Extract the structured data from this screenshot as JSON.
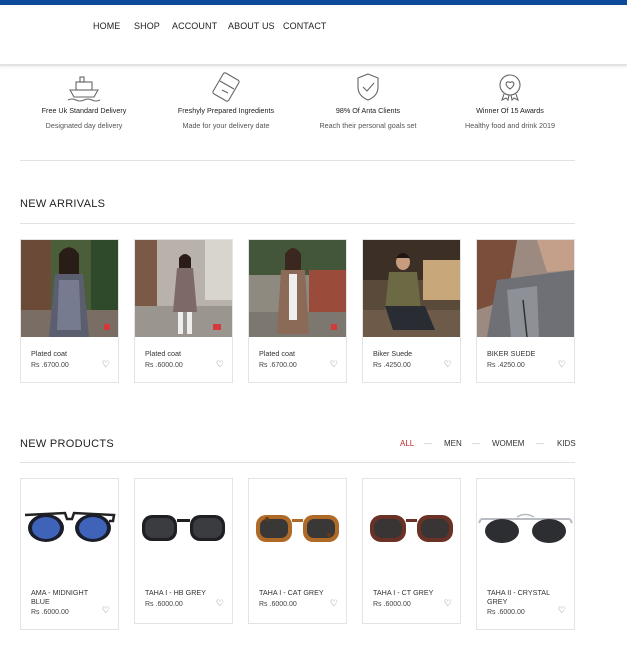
{
  "nav": {
    "items": [
      "HOME",
      "SHOP",
      "ACCOUNT",
      "ABOUT US",
      "CONTACT"
    ]
  },
  "features": [
    {
      "icon": "ship-icon",
      "title": "Free Uk Standard Delivery",
      "subtitle": "Designated day delivery"
    },
    {
      "icon": "credit-card-icon",
      "title": "Freshyly Prepared Ingredients",
      "subtitle": "Made for your delivery date"
    },
    {
      "icon": "shield-check-icon",
      "title": "98% Of Anta Clients",
      "subtitle": "Reach their personal goals set"
    },
    {
      "icon": "heart-badge-icon",
      "title": "Winner Of 15 Awards",
      "subtitle": "Healthy food and drink 2019"
    }
  ],
  "new_arrivals": {
    "title": "NEW ARRIVALS",
    "products": [
      {
        "name": "Plated coat",
        "price": "Rs .6700.00"
      },
      {
        "name": "Plated coat",
        "price": "Rs .6000.00"
      },
      {
        "name": "Plated coat",
        "price": "Rs .6700.00"
      },
      {
        "name": "Biker Suede",
        "price": "Rs .4250.00"
      },
      {
        "name": "BIKER SUEDE",
        "price": "Rs .4250.00"
      }
    ]
  },
  "new_products": {
    "title": "NEW PRODUCTS",
    "filters": [
      "ALL",
      "MEN",
      "WOMEM",
      "KIDS"
    ],
    "active_filter": "ALL",
    "products": [
      {
        "name": "AMA - MIDNIGHT BLUE",
        "price": "Rs .6000.00"
      },
      {
        "name": "TAHA I - HB GREY",
        "price": "Rs .6000.00"
      },
      {
        "name": "TAHA I - CAT GREY",
        "price": "Rs .6000.00"
      },
      {
        "name": "TAHA I - CT GREY",
        "price": "Rs .6000.00"
      },
      {
        "name": "TAHA II - CRYSTAL GREY",
        "price": "Rs .6000.00"
      }
    ]
  },
  "colors": {
    "brand_bar": "#0d4a9b",
    "accent_filter": "#c0282e"
  },
  "icons": {
    "wishlist": "heart-outline-icon"
  }
}
